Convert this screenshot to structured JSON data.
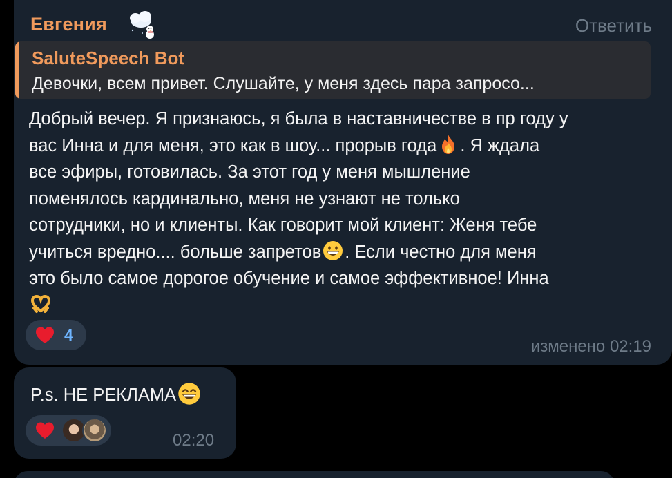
{
  "message1": {
    "sender": "Евгения",
    "sender_emoji": "snowman-cloud-icon",
    "reply_label": "Ответить",
    "quote": {
      "author": "SaluteSpeech Bot",
      "text": "Девочки, всем привет. Слушайте, у меня здесь пара запросо..."
    },
    "body_lines": [
      "Добрый вечер. Я признаюсь, я была в наставничестве в пр году у",
      "вас Инна и для меня, это как  в шоу... прорыв года",
      ". Я ждала",
      "все эфиры, готовилась. За этот год у меня мышление",
      "поменялось кардинально,  меня не узнают не только",
      "сотрудники, но и клиенты. Как говорит мой клиент: Женя тебе",
      "учиться вредно.... больше запретов",
      ".  Если честно для меня",
      "это было самое дорогое обучение и самое эффективное!  Инна"
    ],
    "inline_emojis": [
      "fire-icon",
      "grinning-face-icon",
      "heart-hands-icon"
    ],
    "reaction": {
      "emoji": "red-heart-icon",
      "count": "4"
    },
    "timestamp": "изменено 02:19"
  },
  "message2": {
    "text": "P.s.  НЕ РЕКЛАМА",
    "emoji": "grinning-face-icon",
    "reaction": {
      "emoji": "red-heart-icon",
      "avatars": [
        "user-avatar-1",
        "user-avatar-2"
      ]
    },
    "timestamp": "02:20"
  },
  "colors": {
    "background": "#000000",
    "bubble": "#18222e",
    "accent_name": "#f09a5c",
    "muted": "#6e7b88",
    "quote_bg": "#2a2c31",
    "reaction_bg": "#2d3a4a",
    "reaction_count": "#6fb5ff"
  }
}
